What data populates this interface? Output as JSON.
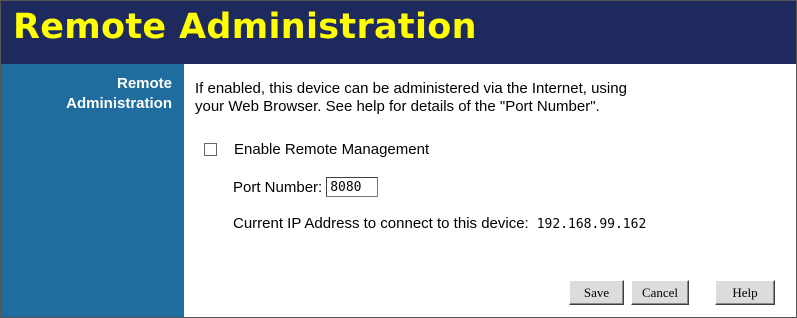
{
  "header": {
    "title": "Remote Administration"
  },
  "sidebar": {
    "label_line1": "Remote",
    "label_line2": "Administration"
  },
  "main": {
    "description_line1": "If enabled, this device can be administered via the Internet, using",
    "description_line2": "your Web Browser. See help for details of the \"Port Number\".",
    "enable_checkbox": {
      "label": "Enable Remote Management",
      "checked": false
    },
    "port": {
      "label": "Port Number:",
      "value": "8080"
    },
    "ip": {
      "label": "Current IP Address to connect to this device:",
      "value": "192.168.99.162"
    }
  },
  "buttons": {
    "save": "Save",
    "cancel": "Cancel",
    "help": "Help"
  },
  "colors": {
    "title_bg": "#1e2a5e",
    "title_text": "#ffff00",
    "sidebar_bg": "#1f6c9e"
  }
}
